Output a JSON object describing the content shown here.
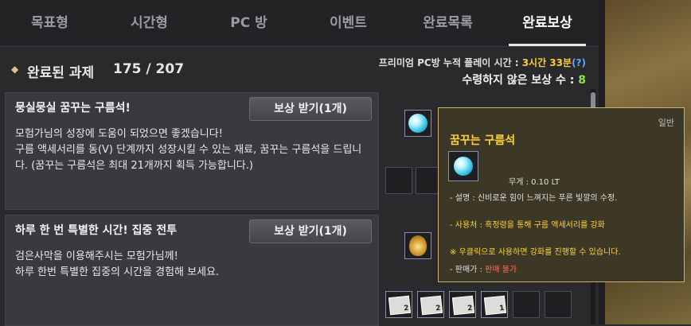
{
  "tabs": [
    {
      "label": "목표형"
    },
    {
      "label": "시간형"
    },
    {
      "label": "PC 방"
    },
    {
      "label": "이벤트"
    },
    {
      "label": "완료목록"
    },
    {
      "label": "완료보상"
    }
  ],
  "header": {
    "title": "완료된 과제",
    "count": "175 / 207",
    "premium_label": "프리미엄 PC방 누적 플레이 시간 : ",
    "premium_value": "3시간 33분",
    "premium_help": "(?)",
    "unclaimed_label": "수령하지 않은 보상 수 : ",
    "unclaimed_value": "8"
  },
  "rewards": [
    {
      "title": "뭉실뭉실 꿈꾸는 구름석!",
      "button": "보상 받기(1개)",
      "description": "모험가님의 성장에 도움이 되었으면 좋겠습니다!\n 구름 액세서리를 동(V) 단계까지 성장시킬 수 있는 재료, 꿈꾸는 구름석을 드립니다. (꿈꾸는 구름석은 최대 21개까지 획득 가능합니다.)"
    },
    {
      "title": "하루 한 번 특별한 시간! 집중 전투",
      "button": "보상 받기(1개)",
      "description": "검은사막을 이용해주시는 모험가님께!\n하루 한번 특별한 집중의 시간을 경험해 보세요."
    }
  ],
  "slot_counts": [
    "2",
    "2",
    "2",
    "1"
  ],
  "tooltip": {
    "grade": "일반",
    "name": "꿈꾸는 구름석",
    "weight": "무게 :  0.10 LT",
    "desc": "- 설명 : 신비로운 힘이 느껴지는 푸른 빛깔의 수정.",
    "usage_label": "- 사용처 : ",
    "usage_value": "흑정령을 통해 구름 액세서리를 강화",
    "note": "※ 우클릭으로 사용하면 강화를 진행할 수 있습니다.",
    "seller_label": "- 판매가 : ",
    "seller_value": "판매 불가"
  },
  "colors": {
    "accent_gold": "#ffd23a",
    "accent_green": "#8fe04a",
    "accent_red": "#ff6a5a"
  }
}
